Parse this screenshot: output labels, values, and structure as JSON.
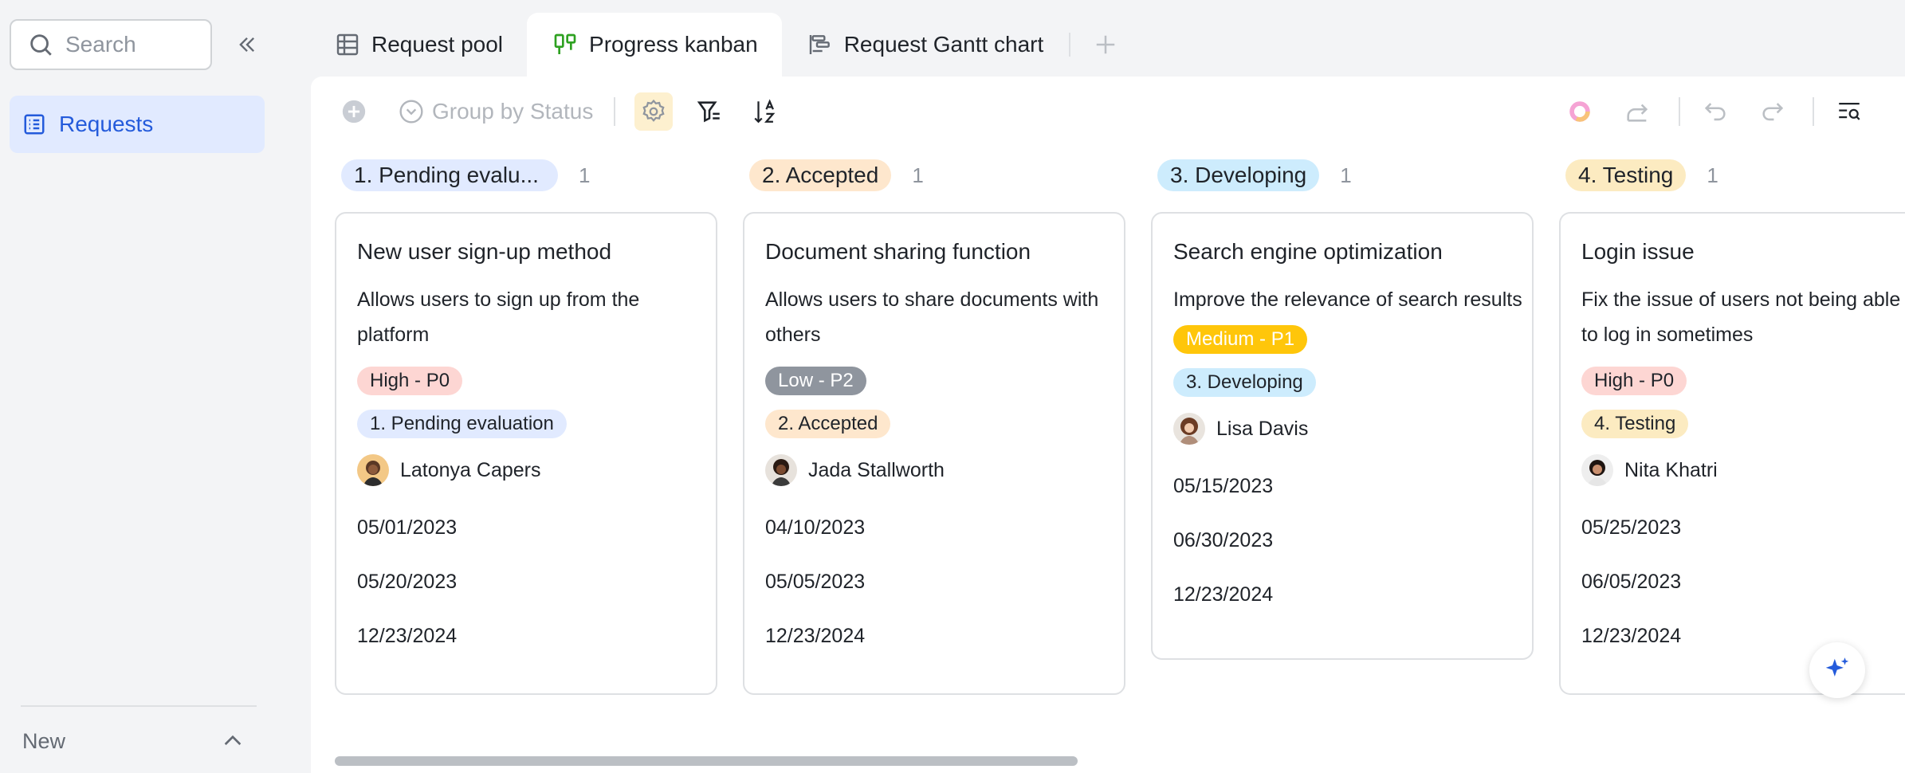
{
  "sidebar": {
    "search_placeholder": "Search",
    "nav_item": "Requests",
    "footer_label": "New"
  },
  "tabs": [
    {
      "label": "Request pool",
      "icon": "table-icon"
    },
    {
      "label": "Progress kanban",
      "icon": "kanban-icon",
      "active": true
    },
    {
      "label": "Request Gantt chart",
      "icon": "gantt-icon"
    }
  ],
  "toolbar": {
    "group_by_label": "Group by Status"
  },
  "columns": [
    {
      "tag": "1. Pending evalu...",
      "tag_color": "#e1eaff",
      "count": "1",
      "card": {
        "title": "New user sign-up method",
        "desc": "Allows users to sign up from the platform",
        "priority": "High - P0",
        "priority_bg": "#fdd6d3",
        "priority_fg": "#1f2329",
        "status": "1. Pending evaluation",
        "status_bg": "#e1eaff",
        "person": "Latonya Capers",
        "date1": "05/01/2023",
        "date2": "05/20/2023",
        "date3": "12/23/2024"
      }
    },
    {
      "tag": "2. Accepted",
      "tag_color": "#fee7cd",
      "count": "1",
      "card": {
        "title": "Document sharing function",
        "desc": "Allows users to share documents with others",
        "priority": "Low - P2",
        "priority_bg": "#8f959e",
        "priority_fg": "#ffffff",
        "status": "2. Accepted",
        "status_bg": "#fee7cd",
        "person": "Jada Stallworth",
        "date1": "04/10/2023",
        "date2": "05/05/2023",
        "date3": "12/23/2024"
      }
    },
    {
      "tag": "3. Developing",
      "tag_color": "#cdecfd",
      "count": "1",
      "card": {
        "title": "Search engine optimization",
        "desc": "Improve the relevance of search results",
        "priority": "Medium - P1",
        "priority_bg": "#ffc60a",
        "priority_fg": "#ffffff",
        "status": "3. Developing",
        "status_bg": "#cdecfd",
        "person": "Lisa Davis",
        "date1": "05/15/2023",
        "date2": "06/30/2023",
        "date3": "12/23/2024"
      }
    },
    {
      "tag": "4. Testing",
      "tag_color": "#fcebc1",
      "count": "1",
      "card": {
        "title": "Login issue",
        "desc": "Fix the issue of users not being able to log in sometimes",
        "priority": "High - P0",
        "priority_bg": "#fdd6d3",
        "priority_fg": "#1f2329",
        "status": "4. Testing",
        "status_bg": "#fcebc1",
        "person": "Nita Khatri",
        "date1": "05/25/2023",
        "date2": "06/05/2023",
        "date3": "12/23/2024"
      }
    }
  ]
}
